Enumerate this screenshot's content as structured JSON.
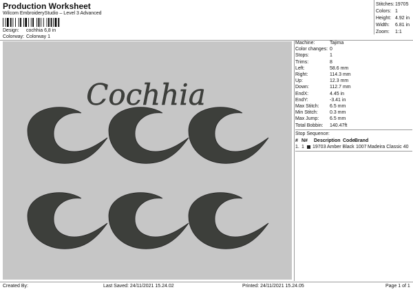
{
  "header": {
    "title": "Production Worksheet",
    "subtitle": "Wilcom EmbroideryStudio – Level 3 Advanced"
  },
  "design": {
    "design_label": "Design:",
    "design_value": "cochhia 6,8 in",
    "colorway_label": "Colorway:",
    "colorway_value": "Colorway 1"
  },
  "stats": [
    {
      "label": "Stitches:",
      "value": "19705"
    },
    {
      "label": "Colors:",
      "value": "1"
    },
    {
      "label": "Height:",
      "value": "4.92 in"
    },
    {
      "label": "Width:",
      "value": "6.81 in"
    },
    {
      "label": "Zoom:",
      "value": "1:1"
    }
  ],
  "artwork": {
    "text": "Cochhia",
    "thread_color": "#3d3f3b",
    "background": "#c6c6c6"
  },
  "info": [
    {
      "label": "Machine:",
      "value": "Tajima"
    },
    {
      "label": "Color changes:",
      "value": "0"
    },
    {
      "label": "Stops:",
      "value": "1"
    },
    {
      "label": "Trims:",
      "value": "8"
    },
    {
      "label": "Left:",
      "value": "58.6 mm"
    },
    {
      "label": "Right:",
      "value": "114.3 mm"
    },
    {
      "label": "Up:",
      "value": "12.3 mm"
    },
    {
      "label": "Down:",
      "value": "112.7 mm"
    },
    {
      "label": "EndX:",
      "value": "4.45 in"
    },
    {
      "label": "EndY:",
      "value": "-3.41 in"
    },
    {
      "label": "Max Stitch:",
      "value": "6.5 mm"
    },
    {
      "label": "Min Stitch:",
      "value": "0.3 mm"
    },
    {
      "label": "Max Jump:",
      "value": "6.5 mm"
    },
    {
      "label": "Total Bobbin:",
      "value": "140.47ft"
    }
  ],
  "stop_sequence": {
    "title": "Stop Sequence:",
    "headers": [
      "#",
      "N#",
      "Description",
      "Code",
      "Brand"
    ],
    "rows": [
      {
        "num": "1.",
        "n": "1",
        "stitches": "19703",
        "description": "Amber Black",
        "code": "1007",
        "brand": "Madeira Classic 40",
        "swatch": "#1e1e1e"
      }
    ]
  },
  "footer": {
    "created_by": "Created By:",
    "last_saved": "Last Saved: 24/11/2021 15.24.02",
    "printed": "Printed: 24/11/2021 15.24.05",
    "page": "Page 1 of 1"
  }
}
